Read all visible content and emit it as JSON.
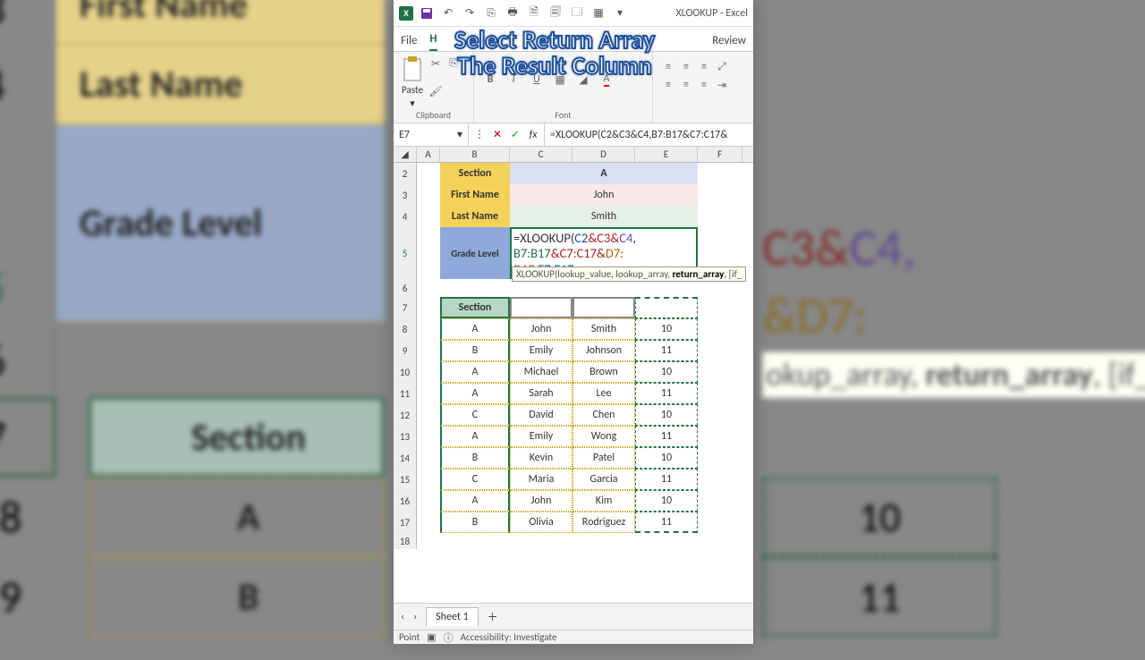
{
  "app_title": "XLOOKUP  -  Excel",
  "overlay_caption_line1": "Select Return Array",
  "overlay_caption_line2": "The Result Column",
  "ribbon_tabs": {
    "file": "File",
    "home": "H",
    "review": "Review"
  },
  "ribbon_groups": {
    "clipboard": "Clipboard",
    "font": "Font",
    "paste": "Paste"
  },
  "name_box": "E7",
  "formula_bar": "=XLOOKUP(C2&C3&C4,B7:B17&C7:C17&",
  "formula_cell": {
    "pieces": {
      "eq": "=",
      "fn": "XLOOKUP",
      "open": "(",
      "c2": "C2",
      "amp1": "&",
      "c3": "C3",
      "amp2": "&",
      "c4": "C4",
      "comma": ",",
      "r1": "B7:B17",
      "amp3": "&",
      "r2": "C7:C17",
      "amp4": "&",
      "r3": "D7:",
      "line3a": "D17",
      "comma2": ",",
      "r4": "E7:E17"
    }
  },
  "tooltip_prefix": "XLOOKUP(lookup_value, lookup_array, ",
  "tooltip_bold": "return_array",
  "tooltip_suffix": ", [if_",
  "columns": {
    "A": "A",
    "B": "B",
    "C": "C",
    "D": "D",
    "E": "E",
    "F": "F"
  },
  "labels": {
    "section": "Section",
    "first": "First Name",
    "last": "Last Name",
    "grade": "Grade Level"
  },
  "inputs": {
    "section": "A",
    "first": "John",
    "last": "Smith"
  },
  "table_header": "Section",
  "rows": [
    {
      "n": "8",
      "s": "A",
      "f": "John",
      "l": "Smith",
      "g": "10"
    },
    {
      "n": "9",
      "s": "B",
      "f": "Emily",
      "l": "Johnson",
      "g": "11"
    },
    {
      "n": "10",
      "s": "A",
      "f": "Michael",
      "l": "Brown",
      "g": "10"
    },
    {
      "n": "11",
      "s": "A",
      "f": "Sarah",
      "l": "Lee",
      "g": "11"
    },
    {
      "n": "12",
      "s": "C",
      "f": "David",
      "l": "Chen",
      "g": "10"
    },
    {
      "n": "13",
      "s": "A",
      "f": "Emily",
      "l": "Wong",
      "g": "11"
    },
    {
      "n": "14",
      "s": "B",
      "f": "Kevin",
      "l": "Patel",
      "g": "10"
    },
    {
      "n": "15",
      "s": "C",
      "f": "Maria",
      "l": "Garcia",
      "g": "11"
    },
    {
      "n": "16",
      "s": "A",
      "f": "John",
      "l": "Kim",
      "g": "10"
    },
    {
      "n": "17",
      "s": "B",
      "f": "Olivia",
      "l": "Rodriguez",
      "g": "11"
    }
  ],
  "row_nums": {
    "r2": "2",
    "r3": "3",
    "r4": "4",
    "r5": "5",
    "r6": "6",
    "r7": "7",
    "r18": "18"
  },
  "sheet_tab": "Sheet 1",
  "status_mode": "Point",
  "accessibility": "Accessibility: Investigate",
  "bg_left": {
    "r3": "3",
    "r4": "4",
    "r5": "5",
    "r6": "6",
    "r7": "7",
    "r8": "8",
    "r9": "9",
    "first": "First Name",
    "last": "Last Name",
    "grade": "Grade Level",
    "section": "Section",
    "A": "A",
    "B": "B"
  },
  "bg_right": {
    "tok1": "C3",
    "amp": "&",
    "tok2": "C4,",
    "tok3": "D7:",
    "tip1": "okup_array, ",
    "tipb": "return_array",
    "tip2": ", [if_",
    "g10": "10",
    "g11": "11"
  }
}
